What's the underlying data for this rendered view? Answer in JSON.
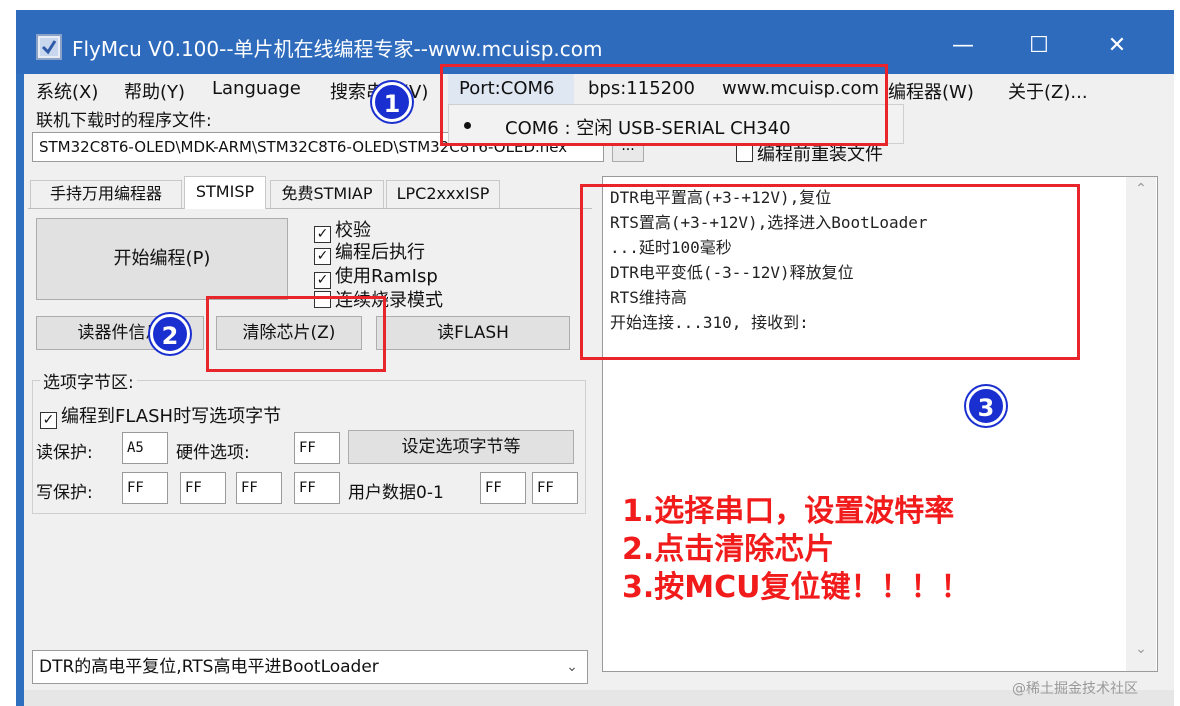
{
  "window": {
    "title": "FlyMcu V0.100--单片机在线编程专家--www.mcuisp.com",
    "minimize_glyph": "—",
    "maximize_glyph": "☐",
    "close_glyph": "✕",
    "colors": {
      "titlebar": "#2e6bbd",
      "annotation_red": "#e8252b",
      "badge_blue": "#1a2fd0"
    }
  },
  "menubar": {
    "items": [
      "系统(X)",
      "帮助(Y)",
      "Language",
      "搜索串口(V)",
      "Port:COM6",
      "bps:115200",
      "www.mcuisp.com",
      "编程器(W)",
      "关于(Z)..."
    ]
  },
  "port_dropdown": {
    "option": "COM6 : 空闲 USB-SERIAL CH340"
  },
  "program_file": {
    "label": "联机下载时的程序文件:",
    "path": "STM32C8T6-OLED\\MDK-ARM\\STM32C8T6-OLED\\STM32C8T6-OLED.hex",
    "browse_label": "...",
    "load_before_label": "编程前重装文件"
  },
  "tabs": [
    "手持万用编程器",
    "STMISP",
    "免费STMIAP",
    "LPC2xxxISP"
  ],
  "stmisp": {
    "start_label": "开始编程(P)",
    "checkboxes": [
      {
        "label": "校验",
        "checked": true
      },
      {
        "label": "编程后执行",
        "checked": true
      },
      {
        "label": "使用RamIsp",
        "checked": true
      },
      {
        "label": "连续烧录模式",
        "checked": false
      }
    ],
    "read_info_label": "读器件信息",
    "erase_label": "清除芯片(Z)",
    "read_flash_label": "读FLASH"
  },
  "option_bytes": {
    "group_label": "选项字节区:",
    "write_on_flash_label": "编程到FLASH时写选项字节",
    "write_on_flash_checked": true,
    "read_protect_label": "读保护:",
    "read_protect_value": "A5",
    "hw_option_label": "硬件选项:",
    "hw_option_value": "FF",
    "set_button_label": "设定选项字节等",
    "write_protect_label": "写保护:",
    "write_protect_values": [
      "FF",
      "FF",
      "FF",
      "FF"
    ],
    "user_data_label": "用户数据0-1",
    "user_data_values": [
      "FF",
      "FF"
    ]
  },
  "reset_mode": {
    "selected": "DTR的高电平复位,RTS高电平进BootLoader",
    "arrow": "⌄"
  },
  "log": {
    "lines": [
      "DTR电平置高(+3-+12V),复位",
      "RTS置高(+3-+12V),选择进入BootLoader",
      "...延时100毫秒",
      "DTR电平变低(-3--12V)释放复位",
      "RTS维持高",
      "开始连接...310, 接收到:"
    ],
    "scroll_up": "⌃",
    "scroll_down": "⌄"
  },
  "annotations": {
    "badges": [
      "1",
      "2",
      "3"
    ],
    "steps": [
      "1.选择串口，设置波特率",
      "2.点击清除芯片",
      "3.按MCU复位键！！！！"
    ]
  },
  "watermark": "@稀土掘金技术社区"
}
